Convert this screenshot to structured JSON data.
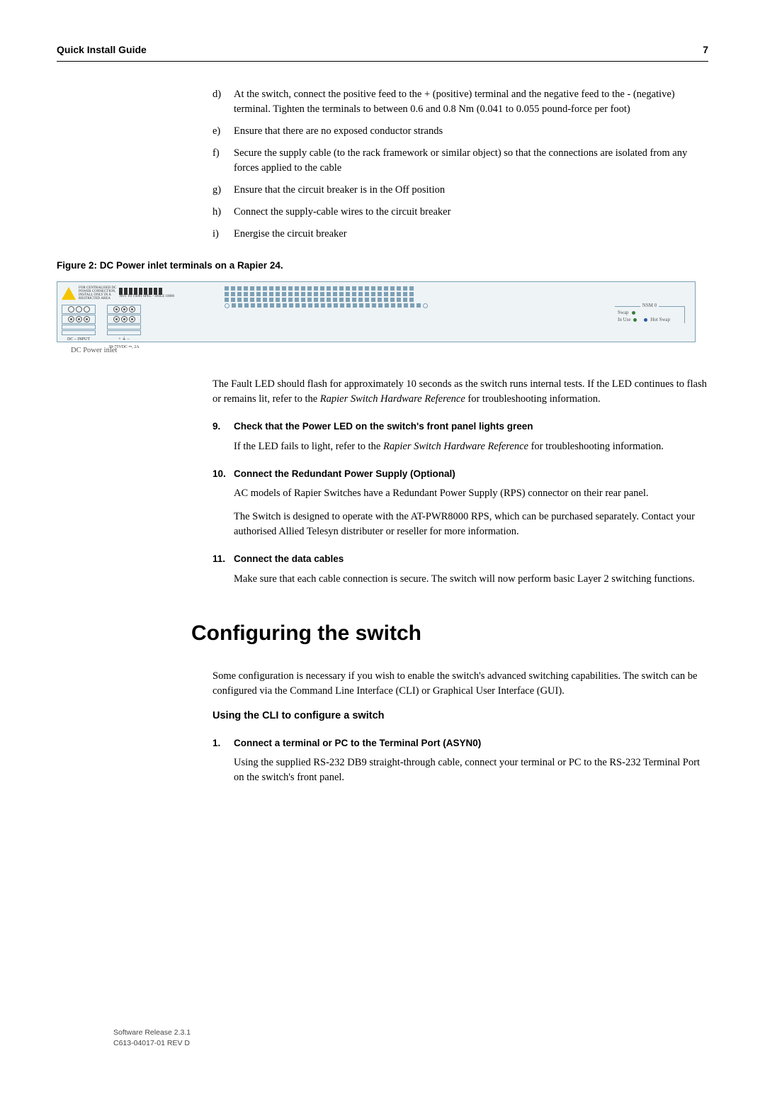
{
  "header": {
    "title": "Quick Install Guide",
    "page": "7"
  },
  "steps_list": {
    "d": "At the switch, connect the positive feed to the + (positive) terminal and the negative feed to the - (negative) terminal. Tighten the terminals to between 0.6 and 0.8 Nm (0.041 to 0.055 pound-force per foot)",
    "e": "Ensure that there are no exposed conductor strands",
    "f": "Secure the supply cable (to the rack framework or similar object) so that the connections are isolated from any forces applied to the cable",
    "g": "Ensure that the circuit breaker is in the Off position",
    "h": "Connect the supply-cable wires to the circuit breaker",
    "i": "Energise the circuit breaker"
  },
  "figure": {
    "caption": "Figure 2: DC Power inlet terminals on a Rapier 24.",
    "warn1": "FOR CENTRALISED DC",
    "warn2": "POWER CONNECTION,",
    "warn3": "INSTALL ONLY IN A",
    "warn4": "RESTRICTED AREA",
    "vent_tiny": "NOT TO TS001 SPEC – HOLE 10000",
    "dc_label": "DC – INPUT",
    "rating": "39-75VDC ⎓, 2A",
    "polarity": "+  ⏚  –",
    "nsm": "NSM 0",
    "swap": "Swap",
    "inuse": "In Use",
    "hotswap": "Hot Swap",
    "callout": "DC Power inlet"
  },
  "fault_led": {
    "p1a": "The Fault LED should flash for approximately 10 seconds as the switch runs internal tests. If the LED continues to flash or remains lit, refer to the ",
    "p1i": "Rapier Switch Hardware Reference",
    "p1b": " for troubleshooting information."
  },
  "step9": {
    "num": "9.",
    "title": "Check that the Power LED on the switch's front panel lights green",
    "p1a": "If the LED fails to light, refer to the ",
    "p1i": "Rapier Switch Hardware Reference",
    "p1b": " for troubleshooting information."
  },
  "step10": {
    "num": "10.",
    "title": "Connect the Redundant Power Supply (Optional)",
    "p1": "AC models of Rapier Switches have a Redundant Power Supply (RPS) connector on their rear panel.",
    "p2": "The Switch is designed to operate with the AT-PWR8000 RPS, which can be purchased separately. Contact your authorised Allied Telesyn distributer or reseller for more information."
  },
  "step11": {
    "num": "11.",
    "title": "Connect the data cables",
    "p1": "Make sure that each cable connection is secure. The switch will now perform basic Layer 2 switching functions."
  },
  "section_heading": "Configuring the switch",
  "config_intro": "Some configuration is necessary if you wish to enable the switch's advanced switching capabilities. The switch can be configured via the Command Line Interface (CLI) or Graphical User Interface (GUI).",
  "cli_sub": "Using the CLI to configure a switch",
  "cli_step1": {
    "num": "1.",
    "title": "Connect a terminal or PC to the Terminal Port (ASYN0)",
    "p1": "Using the supplied RS-232 DB9 straight-through cable, connect your terminal or PC to the RS-232 Terminal Port on the switch's front panel."
  },
  "footer": {
    "l1": "Software Release 2.3.1",
    "l2": "C613-04017-01 REV D"
  }
}
